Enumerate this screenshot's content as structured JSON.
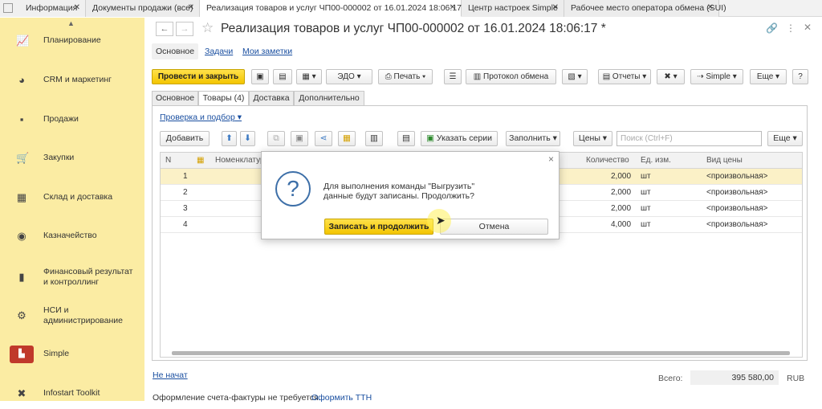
{
  "tabs": [
    {
      "label": "Информация"
    },
    {
      "label": "Документы продажи (все)"
    },
    {
      "label": "Реализация товаров и услуг ЧП00-000002 от 16.01.2024 18:06:17 *"
    },
    {
      "label": "Центр настроек Simple"
    },
    {
      "label": "Рабочее место оператора обмена (SUI)"
    }
  ],
  "sidebar": {
    "items": [
      {
        "label": "Планирование",
        "icon": "chart-icon"
      },
      {
        "label": "CRM и маркетинг",
        "icon": "pie-icon"
      },
      {
        "label": "Продажи",
        "icon": "bag-icon"
      },
      {
        "label": "Закупки",
        "icon": "cart-icon"
      },
      {
        "label": "Склад и доставка",
        "icon": "grid-icon"
      },
      {
        "label": "Казначейство",
        "icon": "coins-icon"
      },
      {
        "label": "Финансовый результат и контроллинг",
        "icon": "bar-chart-icon"
      },
      {
        "label": "НСИ и администрирование",
        "icon": "gear-icon"
      },
      {
        "label": "Simple",
        "icon": "simple-logo-icon"
      },
      {
        "label": "Infostart Toolkit",
        "icon": "tools-icon"
      }
    ]
  },
  "document": {
    "title": "Реализация товаров и услуг ЧП00-000002 от 16.01.2024 18:06:17 *",
    "sections": [
      "Основное",
      "Задачи",
      "Мои заметки"
    ]
  },
  "toolbar": {
    "post_close": "Провести и закрыть",
    "edo": "ЭДО",
    "print": "Печать",
    "exchange_log": "Протокол обмена",
    "reports": "Отчеты",
    "simple": "Simple",
    "more": "Еще",
    "help": "?"
  },
  "inner_tabs": [
    "Основное",
    "Товары (4)",
    "Доставка",
    "Дополнительно"
  ],
  "goods": {
    "pick_link": "Проверка и подбор",
    "add": "Добавить",
    "series": "Указать серии",
    "fill": "Заполнить",
    "prices": "Цены",
    "search_placeholder": "Поиск (Ctrl+F)",
    "more": "Еще"
  },
  "grid": {
    "headers": {
      "n": "N",
      "nom": "Номенклатура",
      "qty": "Количество",
      "unit": "Ед. изм.",
      "price_type": "Вид цены"
    },
    "rows": [
      {
        "n": "1",
        "qty": "2,000",
        "unit": "шт",
        "price_type": "<произвольная>"
      },
      {
        "n": "2",
        "qty": "2,000",
        "unit": "шт",
        "price_type": "<произвольная>"
      },
      {
        "n": "3",
        "qty": "2,000",
        "unit": "шт",
        "price_type": "<произвольная>"
      },
      {
        "n": "4",
        "qty": "4,000",
        "unit": "шт",
        "price_type": "<произвольная>"
      }
    ]
  },
  "footer": {
    "status_link": "Не начат",
    "total_label": "Всего:",
    "total_value": "395 580,00",
    "currency": "RUB",
    "invoice_text": "Оформление счета-фактуры не требуется.",
    "invoice_link": "Оформить ТТН"
  },
  "dialog": {
    "line1": "Для выполнения команды \"Выгрузить\"",
    "line2": "данные будут записаны. Продолжить?",
    "ok": "Записать и продолжить",
    "cancel": "Отмена",
    "close": "×"
  },
  "colors": {
    "accent_yellow": "#f3c500",
    "sidebar_bg": "#fbeca3",
    "link": "#1a4fa0"
  }
}
